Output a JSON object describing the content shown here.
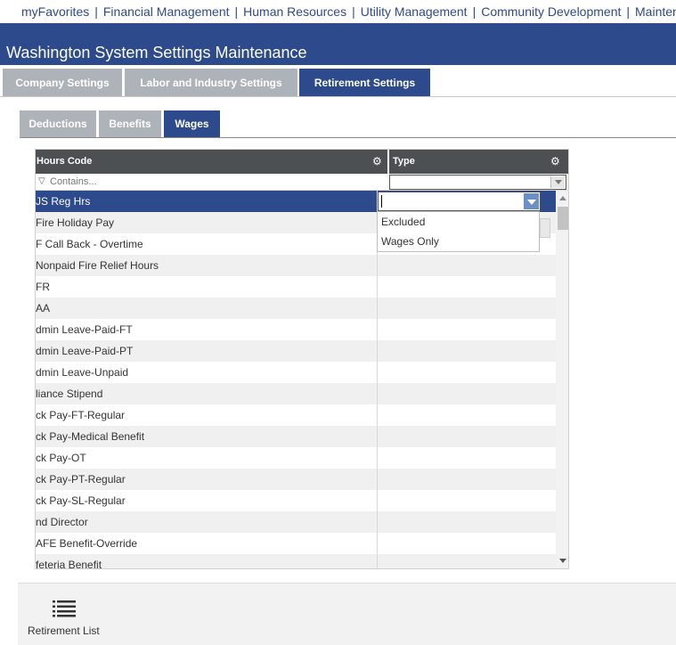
{
  "topnav": {
    "items": [
      "myFavorites",
      "Financial Management",
      "Human Resources",
      "Utility Management",
      "Community Development",
      "Maintenance"
    ],
    "separator": "|"
  },
  "page": {
    "title": "Washington System Settings Maintenance"
  },
  "main_tabs": [
    {
      "label": "Company Settings",
      "active": false
    },
    {
      "label": "Labor and Industry Settings",
      "active": false
    },
    {
      "label": "Retirement Settings",
      "active": true
    }
  ],
  "sub_tabs": [
    {
      "label": "Deductions",
      "active": false
    },
    {
      "label": "Benefits",
      "active": false
    },
    {
      "label": "Wages",
      "active": true
    }
  ],
  "grid": {
    "columns": [
      {
        "label": "Hours Code"
      },
      {
        "label": "Type"
      }
    ],
    "filter_placeholder": "Contains...",
    "rows": [
      {
        "hours_code": "JS Reg Hrs",
        "type": "",
        "selected": true
      },
      {
        "hours_code": " Fire Holiday Pay",
        "type": ""
      },
      {
        "hours_code": "F Call Back - Overtime",
        "type": ""
      },
      {
        "hours_code": " Nonpaid Fire Relief Hours",
        "type": ""
      },
      {
        "hours_code": " FR",
        "type": ""
      },
      {
        "hours_code": "AA",
        "type": ""
      },
      {
        "hours_code": "dmin Leave-Paid-FT",
        "type": ""
      },
      {
        "hours_code": "dmin Leave-Paid-PT",
        "type": ""
      },
      {
        "hours_code": "dmin Leave-Unpaid",
        "type": ""
      },
      {
        "hours_code": "liance Stipend",
        "type": ""
      },
      {
        "hours_code": "ck Pay-FT-Regular",
        "type": ""
      },
      {
        "hours_code": "ck Pay-Medical Benefit",
        "type": ""
      },
      {
        "hours_code": "ck Pay-OT",
        "type": ""
      },
      {
        "hours_code": "ck Pay-PT-Regular",
        "type": ""
      },
      {
        "hours_code": "ck Pay-SL-Regular",
        "type": ""
      },
      {
        "hours_code": "nd Director",
        "type": ""
      },
      {
        "hours_code": "AFE Benefit-Override",
        "type": ""
      },
      {
        "hours_code": "feteria Benefit",
        "type": ""
      }
    ],
    "type_dropdown": {
      "value": "",
      "options": [
        "Excluded",
        "Wages Only"
      ]
    }
  },
  "bottom_bar": {
    "retirement_list_label": "Retirement List"
  },
  "colors": {
    "brand_blue": "#2c4a8c",
    "inactive_tab": "#adb3b8",
    "grid_header": "#4d5052",
    "dropdown_arrow": "#6b8fc6"
  }
}
